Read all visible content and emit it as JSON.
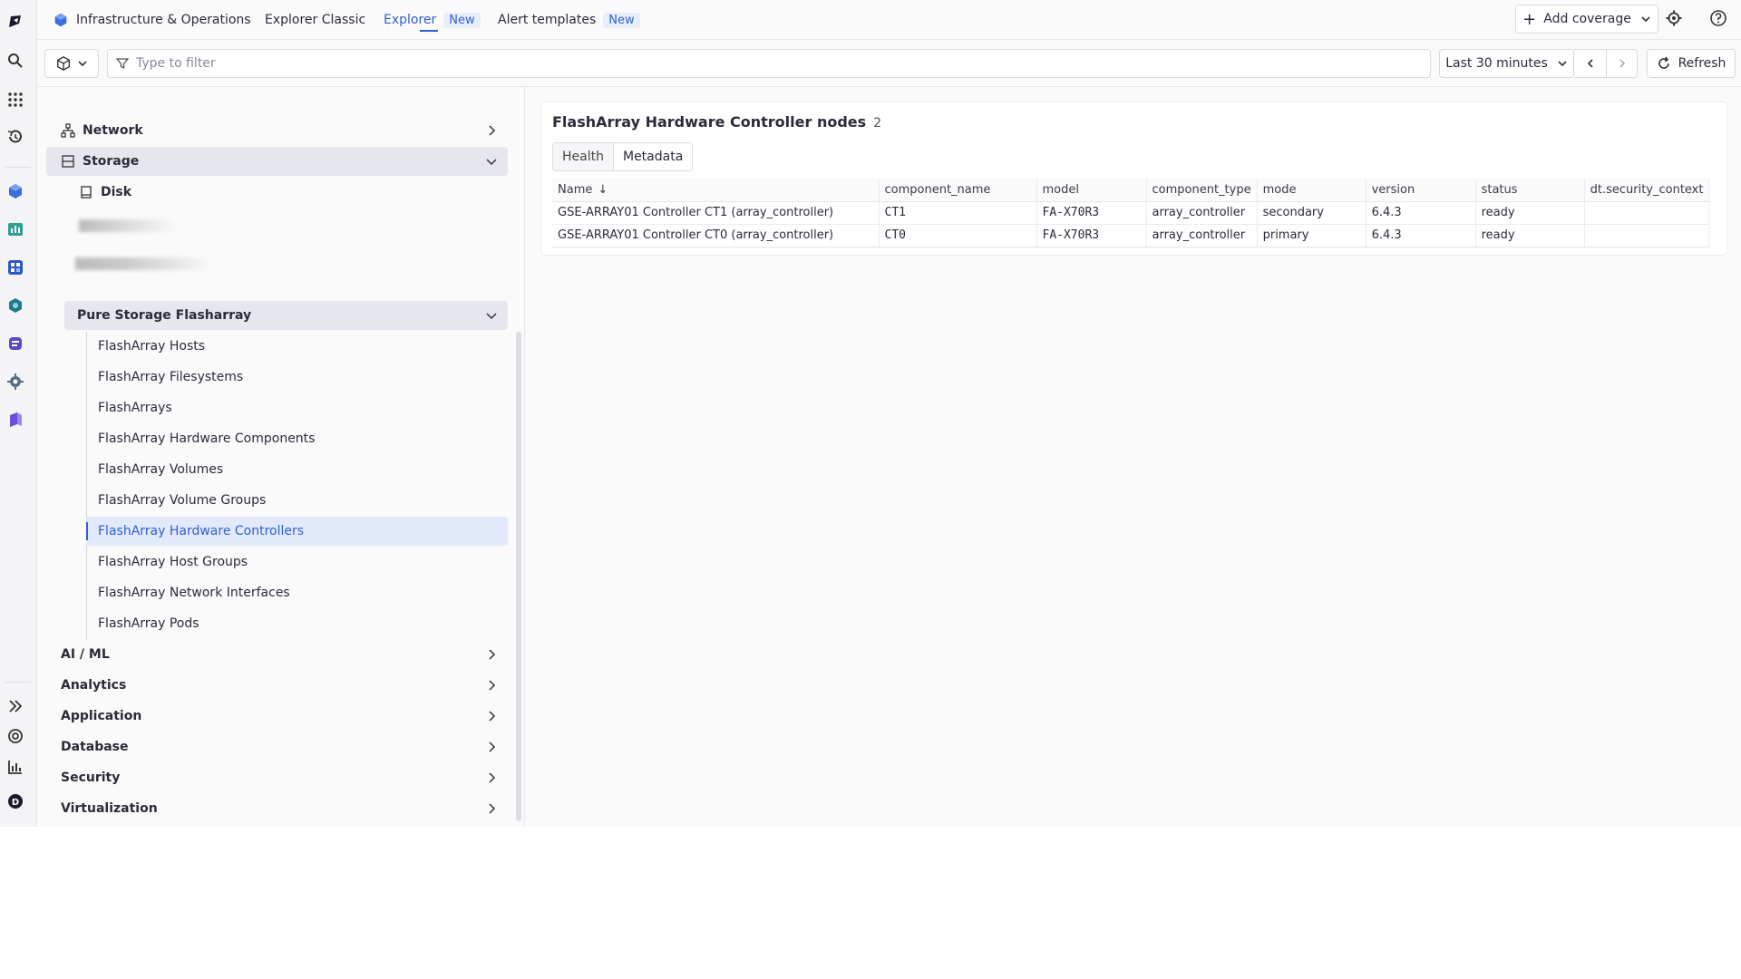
{
  "topbar": {
    "app_title": "Infrastructure & Operations",
    "tabs": [
      {
        "label": "Explorer Classic",
        "badge": ""
      },
      {
        "label": "Explorer",
        "badge": "New"
      },
      {
        "label": "Alert templates",
        "badge": "New"
      }
    ],
    "add_coverage_label": "Add coverage"
  },
  "filterbar": {
    "filter_placeholder": "Type to filter",
    "timeframe_label": "Last 30 minutes",
    "refresh_label": "Refresh"
  },
  "sidebar": {
    "network_label": "Network",
    "storage_label": "Storage",
    "disk_label": "Disk",
    "pure_group_label": "Pure Storage Flasharray",
    "pure_items": [
      "FlashArray Hosts",
      "FlashArray Filesystems",
      "FlashArrays",
      "FlashArray Hardware Components",
      "FlashArray Volumes",
      "FlashArray Volume Groups",
      "FlashArray Hardware Controllers",
      "FlashArray Host Groups",
      "FlashArray Network Interfaces",
      "FlashArray Pods"
    ],
    "groups": [
      "AI / ML",
      "Analytics",
      "Application",
      "Database",
      "Security",
      "Virtualization"
    ]
  },
  "main": {
    "title": "FlashArray Hardware Controller nodes",
    "count": "2",
    "tabs": [
      "Health",
      "Metadata"
    ],
    "columns": [
      "Name",
      "component_name",
      "model",
      "component_type",
      "mode",
      "version",
      "status",
      "dt.security_context"
    ],
    "rows": [
      [
        "GSE-ARRAY01 Controller CT1 (array_controller)",
        "CT1",
        "FA-X70R3",
        "array_controller",
        "secondary",
        "6.4.3",
        "ready",
        ""
      ],
      [
        "GSE-ARRAY01 Controller CT0 (array_controller)",
        "CT0",
        "FA-X70R3",
        "array_controller",
        "primary",
        "6.4.3",
        "ready",
        ""
      ]
    ]
  },
  "colors": {
    "accent": "#2f5fd0",
    "active_bg": "#e2e9fb"
  }
}
